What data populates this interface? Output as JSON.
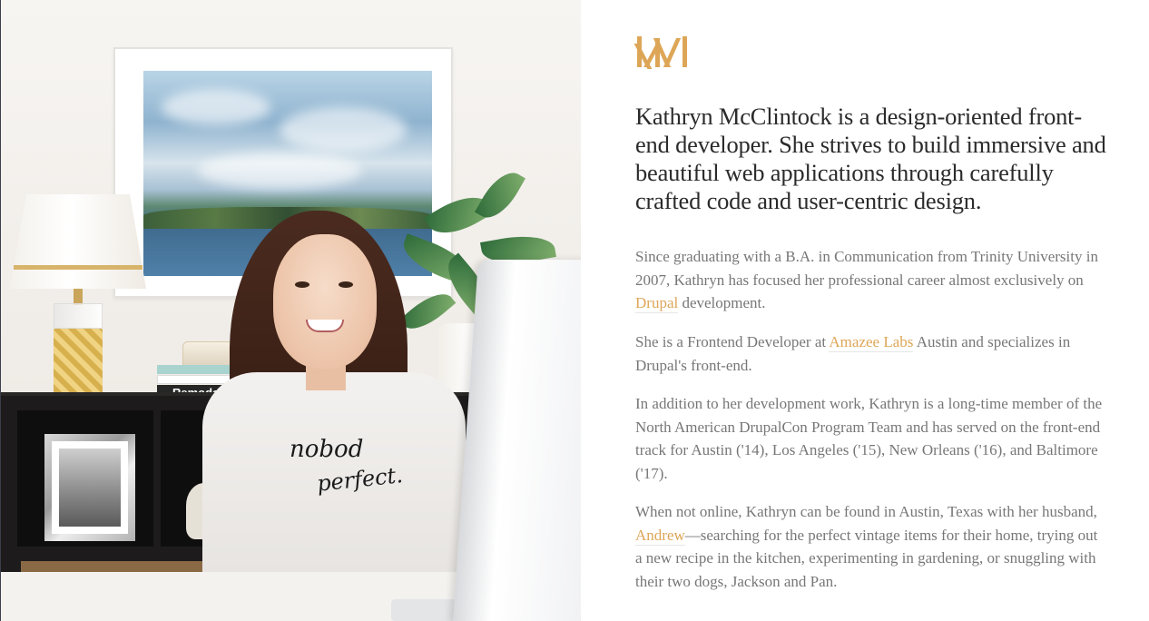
{
  "brand": {
    "logo_initials": "KM",
    "accent_color": "#dda657"
  },
  "photo": {
    "alt": "Kathryn McClintock smiling at her desk",
    "book_spine_label": "Remodel",
    "shirt_line_1": "nobod",
    "shirt_line_2": "perfect."
  },
  "intro": "Kathryn McClintock is a design-oriented front-end developer. She strives to build immersive and beautiful web applications through carefully crafted code and user-centric design.",
  "paragraphs": {
    "p1": {
      "before": "Since graduating with a B.A. in Communication from Trinity University in 2007, Kathryn has focused her professional career almost exclusively on ",
      "link": "Drupal",
      "after": " development."
    },
    "p2": {
      "before": "She is a Frontend Developer at ",
      "link": "Amazee Labs",
      "after": " Austin and specializes in Drupal's front-end."
    },
    "p3": {
      "text": "In addition to her development work, Kathryn is a long-time member of the North American DrupalCon Program Team and has served on the front-end track for Austin ('14), Los Angeles ('15), New Orleans ('16), and Baltimore ('17)."
    },
    "p4": {
      "before": "When not online, Kathryn can be found in Austin, Texas with her husband, ",
      "link": "Andrew",
      "after": "—searching for the perfect vintage items for their home, trying out a new recipe in the kitchen, experimenting in gardening, or snuggling with their two dogs, Jackson and Pan."
    }
  }
}
